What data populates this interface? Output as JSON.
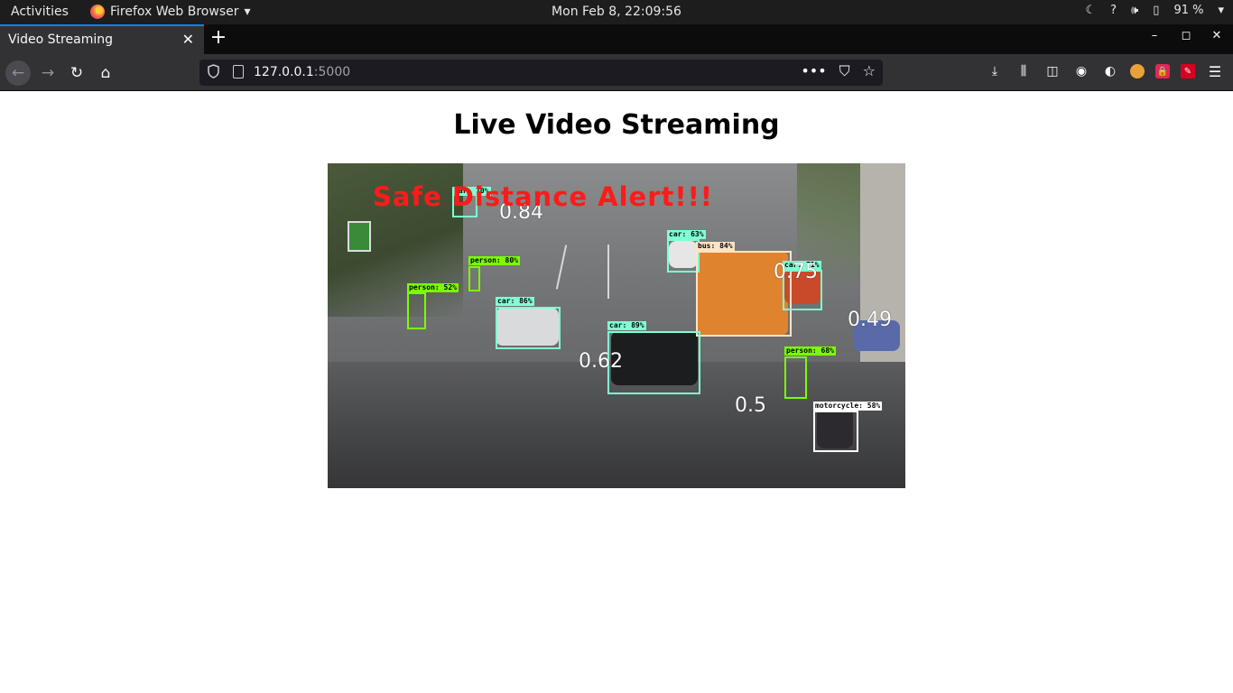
{
  "topbar": {
    "activities": "Activities",
    "app_name": "Firefox Web Browser",
    "clock": "Mon Feb  8, 22:09:56",
    "battery": "91 %",
    "icons": [
      "night-light-icon",
      "help-icon",
      "volume-icon",
      "battery-icon",
      "chevron-down-icon"
    ]
  },
  "browser": {
    "tab_title": "Video Streaming",
    "url_host": "127.0.0.1",
    "url_port": ":5000",
    "toolbar_icons": [
      "download-icon",
      "library-icon",
      "sidebar-icon",
      "account-icon",
      "extension-icon",
      "extension-icon",
      "extension-icon",
      "extension-icon",
      "menu-icon"
    ]
  },
  "page": {
    "heading": "Live Video Streaming"
  },
  "video": {
    "alert": "Safe Distance Alert!!!",
    "detections": [
      {
        "label": "car: 70%",
        "color": "#7fffd4"
      },
      {
        "label": "person: 80%",
        "color": "#7cfc00"
      },
      {
        "label": "person: 52%",
        "color": "#7cfc00"
      },
      {
        "label": "car: 86%",
        "color": "#7fffd4"
      },
      {
        "label": "car: 63%",
        "color": "#7fffd4"
      },
      {
        "label": "bus: 84%",
        "color": "#ffe4c4"
      },
      {
        "label": "car: 71%",
        "color": "#7fffd4"
      },
      {
        "label": "car: 89%",
        "color": "#7fffd4"
      },
      {
        "label": "person: 68%",
        "color": "#7cfc00"
      },
      {
        "label": "motorcycle: 58%",
        "color": "#ffffff"
      }
    ],
    "distances": [
      "0.84",
      "0.62",
      "0.5",
      "0.49",
      "0.75"
    ]
  }
}
